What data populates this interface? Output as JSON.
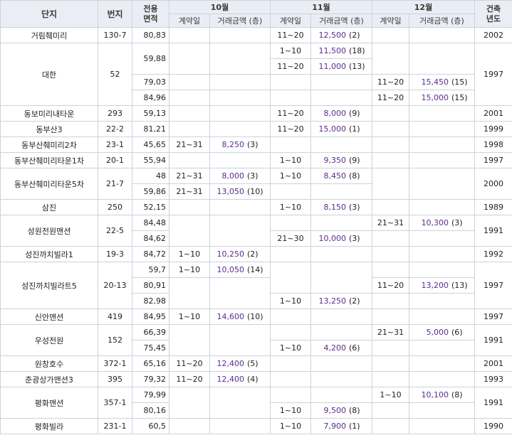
{
  "headers": {
    "complex": "단지",
    "lot": "번지",
    "area": "전용\n면적",
    "oct": "10월",
    "nov": "11월",
    "dec": "12월",
    "built": "건축\n년도",
    "contract_day": "계약일",
    "amount": "거래금액 (층)"
  },
  "cells": {
    "r0c0": "거림췌미리",
    "r0c1": "130-7",
    "r0c2": "80,83",
    "r0c5": "11~20",
    "r0c6a": "12,500",
    "r0c6b": "(2)",
    "r0c9": "2002",
    "r1c0": "대한",
    "r1c1": "52",
    "r1c2": "59,88",
    "r1c5": "1~10",
    "r1c6a": "11,500",
    "r1c6b": "(18)",
    "r1c9": "1997",
    "r2c5": "11~20",
    "r2c6a": "11,000",
    "r2c6b": "(13)",
    "r3c2": "79,03",
    "r3c7": "11~20",
    "r3c8a": "15,450",
    "r3c8b": "(15)",
    "r4c2": "84,96",
    "r4c7": "11~20",
    "r4c8a": "15,000",
    "r4c8b": "(15)",
    "r5c0": "동보미리내타운",
    "r5c1": "293",
    "r5c2": "59,13",
    "r5c5": "11~20",
    "r5c6a": "8,000",
    "r5c6b": "(9)",
    "r5c9": "2001",
    "r6c0": "동부산3",
    "r6c1": "22-2",
    "r6c2": "81,21",
    "r6c5": "11~20",
    "r6c6a": "15,000",
    "r6c6b": "(1)",
    "r6c9": "1999",
    "r7c0": "동부산췌미리2차",
    "r7c1": "23-1",
    "r7c2": "45,65",
    "r7c3": "21~31",
    "r7c4a": "8,250",
    "r7c4b": "(3)",
    "r7c9": "1998",
    "r8c0": "동부산췌미리타운1차",
    "r8c1": "20-1",
    "r8c2": "55,94",
    "r8c5": "1~10",
    "r8c6a": "9,350",
    "r8c6b": "(9)",
    "r8c9": "1997",
    "r9c0": "동부산췌미리타운5차",
    "r9c1": "21-7",
    "r9c2": "48",
    "r9c3": "21~31",
    "r9c4a": "8,000",
    "r9c4b": "(3)",
    "r9c5": "1~10",
    "r9c6a": "8,450",
    "r9c6b": "(8)",
    "r9c9": "2000",
    "r10c2": "59,86",
    "r10c3": "21~31",
    "r10c4a": "13,050",
    "r10c4b": "(10)",
    "r11c0": "삼진",
    "r11c1": "250",
    "r11c2": "52,15",
    "r11c5": "1~10",
    "r11c6a": "8,150",
    "r11c6b": "(3)",
    "r11c9": "1989",
    "r12c0": "성원전원맨션",
    "r12c1": "22-5",
    "r12c2": "84,48",
    "r12c7": "21~31",
    "r12c8a": "10,300",
    "r12c8b": "(3)",
    "r12c9": "1991",
    "r13c2": "84,62",
    "r13c5": "21~30",
    "r13c6a": "10,000",
    "r13c6b": "(3)",
    "r14c0": "성진까치빌라1",
    "r14c1": "19-3",
    "r14c2": "84,72",
    "r14c3": "1~10",
    "r14c4a": "10,250",
    "r14c4b": "(2)",
    "r14c9": "1992",
    "r15c0": "성진까치빌라트5",
    "r15c1": "20-13",
    "r15c2": "59,7",
    "r15c3": "1~10",
    "r15c4a": "10,050",
    "r15c4b": "(14)",
    "r15c9": "1997",
    "r16c2": "80,91",
    "r16c7": "11~20",
    "r16c8a": "13,200",
    "r16c8b": "(13)",
    "r17c2": "82,98",
    "r17c5": "1~10",
    "r17c6a": "13,250",
    "r17c6b": "(2)",
    "r18c0": "신안맨션",
    "r18c1": "419",
    "r18c2": "84,95",
    "r18c3": "1~10",
    "r18c4a": "14,600",
    "r18c4b": "(10)",
    "r18c9": "1997",
    "r19c0": "우성전원",
    "r19c1": "152",
    "r19c2": "66,39",
    "r19c7": "21~31",
    "r19c8a": "5,000",
    "r19c8b": "(6)",
    "r19c9": "1991",
    "r20c2": "75,45",
    "r20c5": "1~10",
    "r20c6a": "4,200",
    "r20c6b": "(6)",
    "r21c0": "원창호수",
    "r21c1": "372-1",
    "r21c2": "65,16",
    "r21c3": "11~20",
    "r21c4a": "12,400",
    "r21c4b": "(5)",
    "r21c9": "2001",
    "r22c0": "춘광상가맨션3",
    "r22c1": "395",
    "r22c2": "79,32",
    "r22c3": "11~20",
    "r22c4a": "12,400",
    "r22c4b": "(4)",
    "r22c9": "1993",
    "r23c0": "평화맨션",
    "r23c1": "357-1",
    "r23c2": "79,99",
    "r23c7": "1~10",
    "r23c8a": "10,100",
    "r23c8b": "(8)",
    "r23c9": "1991",
    "r24c2": "80,16",
    "r24c5": "1~10",
    "r24c6a": "9,500",
    "r24c6b": "(8)",
    "r25c0": "평화빌라",
    "r25c1": "231-1",
    "r25c2": "60,5",
    "r25c5": "1~10",
    "r25c6a": "7,900",
    "r25c6b": "(1)",
    "r25c9": "1990"
  }
}
